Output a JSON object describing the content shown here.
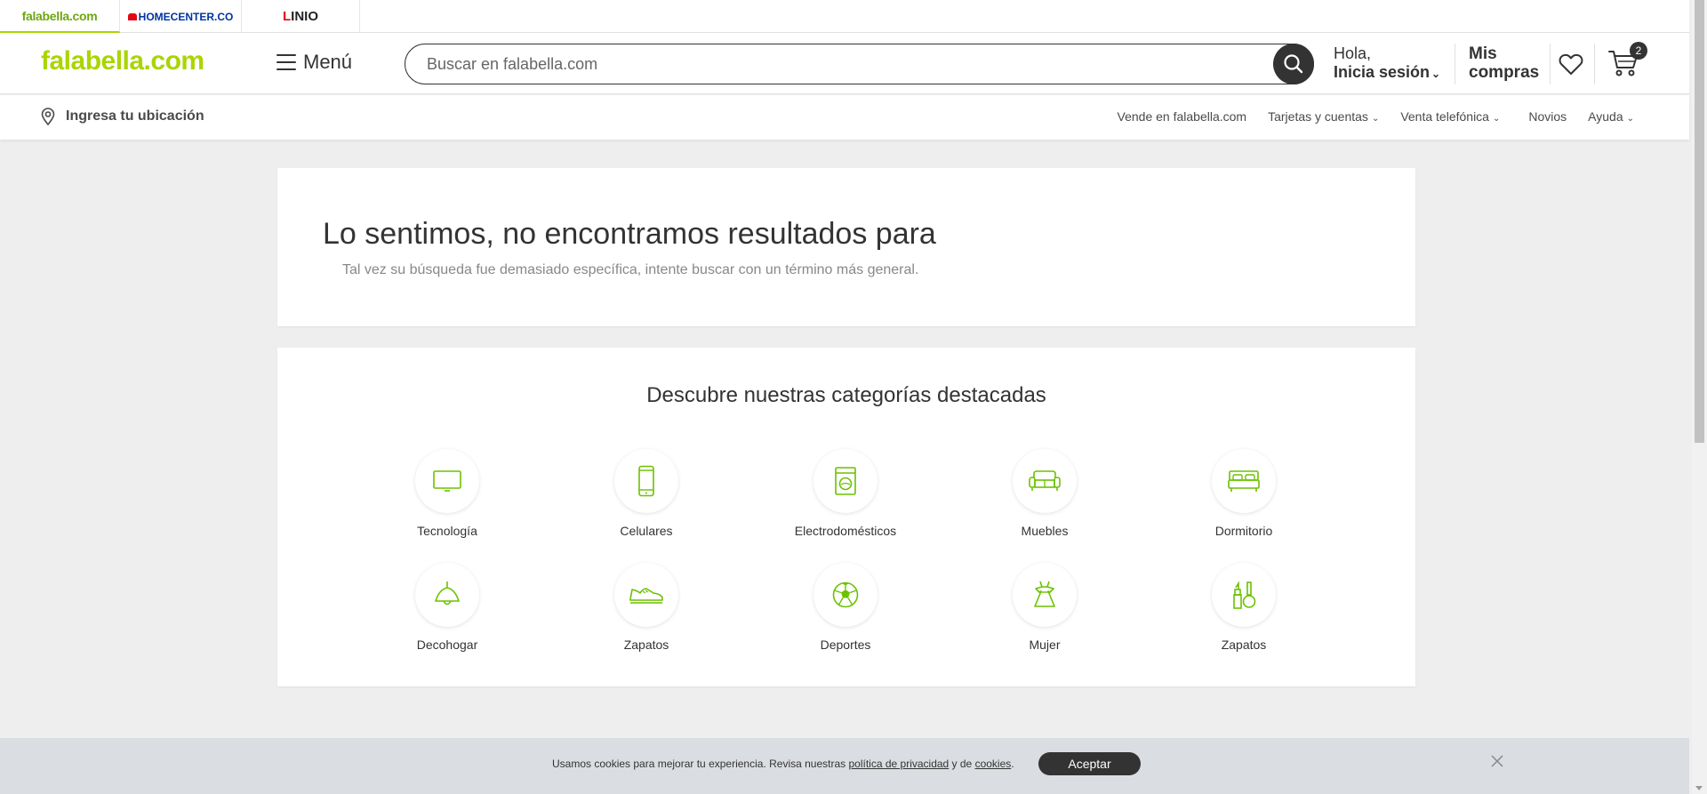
{
  "brands": [
    {
      "name": "falabella.com"
    },
    {
      "name": "HOMECENTER.CO"
    },
    {
      "name_prefix": "L",
      "name_rest": "INIO"
    }
  ],
  "header": {
    "logo": "falabella.com",
    "menu_label": "Menú",
    "search_placeholder": "Buscar en falabella.com",
    "login_line1": "Hola,",
    "login_line2": "Inicia sesión",
    "purchases_line1": "Mis",
    "purchases_line2": "compras",
    "cart_count": "2"
  },
  "subheader": {
    "location_label": "Ingresa tu ubicación",
    "nav": [
      {
        "label": "Vende en falabella.com"
      },
      {
        "label": "Tarjetas y cuentas"
      },
      {
        "label": "Venta telefónica"
      },
      {
        "label": "Novios"
      },
      {
        "label": "Ayuda"
      }
    ]
  },
  "no_results": {
    "title": "Lo sentimos, no encontramos resultados para",
    "subtitle": "Tal vez su búsqueda fue demasiado específica, intente buscar con un término más general."
  },
  "categories": {
    "title": "Descubre nuestras categorías destacadas",
    "items": [
      {
        "label": "Tecnología",
        "icon": "tv-icon"
      },
      {
        "label": "Celulares",
        "icon": "phone-icon"
      },
      {
        "label": "Electrodomésticos",
        "icon": "washer-icon"
      },
      {
        "label": "Muebles",
        "icon": "sofa-icon"
      },
      {
        "label": "Dormitorio",
        "icon": "bed-icon"
      },
      {
        "label": "Decohogar",
        "icon": "lamp-icon"
      },
      {
        "label": "Zapatos",
        "icon": "shoe-icon"
      },
      {
        "label": "Deportes",
        "icon": "soccer-ball-icon"
      },
      {
        "label": "Mujer",
        "icon": "dress-icon"
      },
      {
        "label": "Zapatos",
        "icon": "makeup-icon"
      }
    ]
  },
  "cookie": {
    "text_before": "Usamos cookies para mejorar tu experiencia. Revisa nuestras ",
    "privacy_link": "política de privacidad",
    "text_middle": " y de ",
    "cookies_link": "cookies",
    "text_after": ".",
    "accept_label": "Aceptar"
  },
  "colors": {
    "brand_green": "#aad500",
    "dark": "#333333",
    "icon_green": "#6cc100"
  }
}
